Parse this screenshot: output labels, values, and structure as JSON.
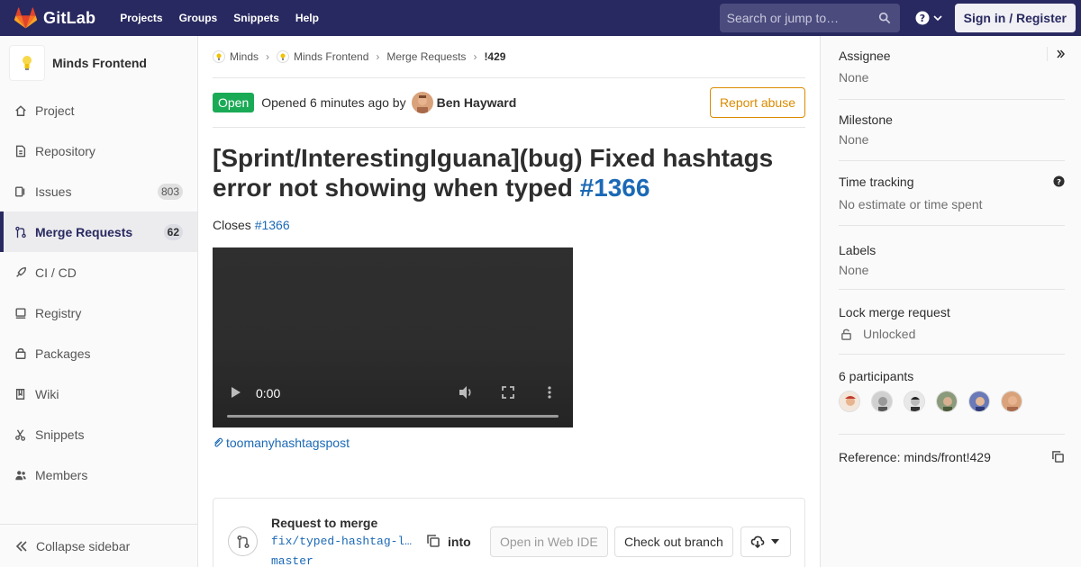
{
  "navbar": {
    "brand": "GitLab",
    "links": [
      "Projects",
      "Groups",
      "Snippets",
      "Help"
    ],
    "search_placeholder": "Search or jump to…",
    "signin_label": "Sign in / Register"
  },
  "sidebar": {
    "project_name": "Minds Frontend",
    "items": [
      {
        "label": "Project",
        "icon": "home-icon",
        "badge": ""
      },
      {
        "label": "Repository",
        "icon": "doc-icon",
        "badge": ""
      },
      {
        "label": "Issues",
        "icon": "issues-icon",
        "badge": "803"
      },
      {
        "label": "Merge Requests",
        "icon": "merge-request-icon",
        "badge": "62"
      },
      {
        "label": "CI / CD",
        "icon": "rocket-icon",
        "badge": ""
      },
      {
        "label": "Registry",
        "icon": "container-icon",
        "badge": ""
      },
      {
        "label": "Packages",
        "icon": "package-icon",
        "badge": ""
      },
      {
        "label": "Wiki",
        "icon": "book-icon",
        "badge": ""
      },
      {
        "label": "Snippets",
        "icon": "scissors-icon",
        "badge": ""
      },
      {
        "label": "Members",
        "icon": "users-icon",
        "badge": ""
      }
    ],
    "collapse_label": "Collapse sidebar"
  },
  "breadcrumb": {
    "items": [
      "Minds",
      "Minds Frontend",
      "Merge Requests"
    ],
    "current": "!429"
  },
  "mr": {
    "status": "Open",
    "opened_text": "Opened 6 minutes ago by",
    "author": "Ben Hayward",
    "report_label": "Report abuse",
    "title": "[Sprint/InterestingIguana](bug) Fixed hashtags error not showing when typed",
    "title_ref": "#1366",
    "closes_label": "Closes",
    "closes_ref": "#1366",
    "video_time": "0:00",
    "attachment": "toomanyhashtagspost"
  },
  "merge_widget": {
    "title": "Request to merge",
    "source_branch": "fix/typed-hashtag-length-error",
    "into_label": "into",
    "target_branch": "master",
    "ide_label": "Open in Web IDE",
    "checkout_label": "Check out branch"
  },
  "right_sidebar": {
    "assignee": {
      "title": "Assignee",
      "value": "None"
    },
    "milestone": {
      "title": "Milestone",
      "value": "None"
    },
    "time_tracking": {
      "title": "Time tracking",
      "value": "No estimate or time spent"
    },
    "labels": {
      "title": "Labels",
      "value": "None"
    },
    "lock": {
      "title": "Lock merge request",
      "value": "Unlocked"
    },
    "participants": {
      "title": "6 participants",
      "count": 6
    },
    "reference": "Reference: minds/front!429"
  },
  "colors": {
    "navbar": "#292961",
    "status_open": "#1aaa55",
    "link": "#1b69b6",
    "report": "#db8b00"
  }
}
